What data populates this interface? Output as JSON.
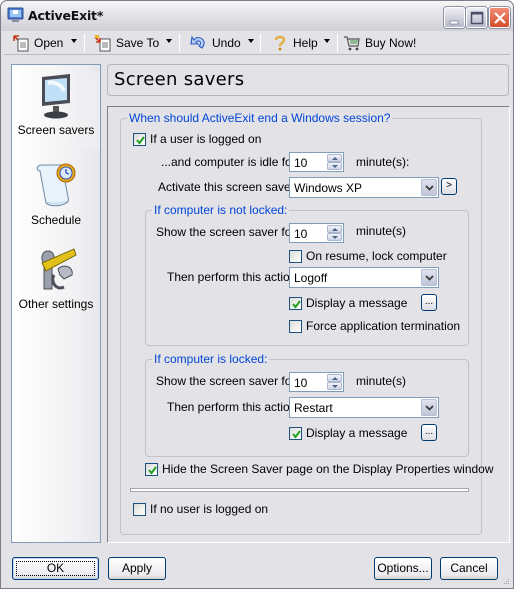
{
  "window": {
    "title": "ActiveExit*",
    "controls": [
      "minimize",
      "maximize",
      "close"
    ]
  },
  "toolbar": {
    "items": [
      {
        "label": "Open",
        "icon": "open-folder-icon",
        "has_dropdown": true
      },
      {
        "label": "Save To",
        "icon": "save-to-icon",
        "has_dropdown": true
      },
      {
        "label": "Undo",
        "icon": "undo-icon",
        "has_dropdown": true
      },
      {
        "label": "Help",
        "icon": "help-question-icon",
        "has_dropdown": true
      },
      {
        "label": "Buy Now!",
        "icon": "shopping-cart-icon",
        "has_dropdown": false
      }
    ]
  },
  "sidebar": {
    "items": [
      {
        "label": "Screen savers",
        "icon": "monitor-icon",
        "active": true
      },
      {
        "label": "Schedule",
        "icon": "schedule-scroll-clock-icon",
        "active": false
      },
      {
        "label": "Other settings",
        "icon": "tools-wrench-hammer-icon",
        "active": false
      }
    ]
  },
  "page": {
    "title": "Screen savers",
    "main_group": {
      "legend": "When should ActiveExit end a Windows session?",
      "user_logged_on": {
        "label": "If a user is logged on",
        "checked": true
      },
      "idle": {
        "label": "...and computer is idle for:",
        "value": "10",
        "unit": "minute(s):"
      },
      "activate": {
        "label": "Activate this screen saver:",
        "value": "Windows XP",
        "preview_label": ">"
      },
      "not_locked": {
        "legend": "If computer is not locked:",
        "show_for": {
          "label": "Show the screen saver for:",
          "value": "10",
          "unit": "minute(s)"
        },
        "lock_on_resume": {
          "label": "On resume, lock computer",
          "checked": false
        },
        "action": {
          "label": "Then perform this action:",
          "value": "Logoff"
        },
        "display_message": {
          "label": "Display a message",
          "checked": true,
          "button": "..."
        },
        "force_termination": {
          "label": "Force application termination",
          "checked": false
        }
      },
      "locked": {
        "legend": "If computer is locked:",
        "show_for": {
          "label": "Show the screen saver for:",
          "value": "10",
          "unit": "minute(s)"
        },
        "action": {
          "label": "Then perform this action:",
          "value": "Restart"
        },
        "display_message": {
          "label": "Display a message",
          "checked": true,
          "button": "..."
        }
      },
      "hide_page": {
        "label": "Hide the Screen Saver page on the Display Properties window",
        "checked": true
      },
      "no_user": {
        "label": "If no user is logged on",
        "checked": false
      }
    }
  },
  "footer": {
    "ok": "OK",
    "apply": "Apply",
    "options": "Options...",
    "cancel": "Cancel"
  }
}
